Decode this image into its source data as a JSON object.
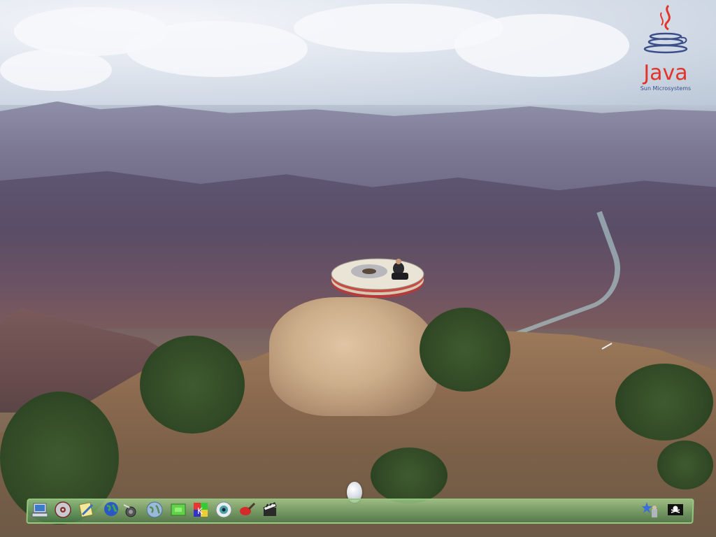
{
  "java_logo": {
    "word": "Java",
    "subtitle": "Sun Microsystems"
  },
  "colors": {
    "java_red": "#e2342a",
    "java_blue": "#3b4e8a",
    "dock_green": "#8cc67a"
  },
  "dock": {
    "icons": [
      "computer-icon",
      "cd-disc-icon",
      "notepad-pencil-icon",
      "globe-icon",
      "network-gear-icon",
      "world-map-icon",
      "green-window-icon",
      "color-palette-icon",
      "eye-icon",
      "paint-brush-icon",
      "film-clapper-icon",
      "star-user-icon",
      "pirate-flag-icon"
    ]
  }
}
